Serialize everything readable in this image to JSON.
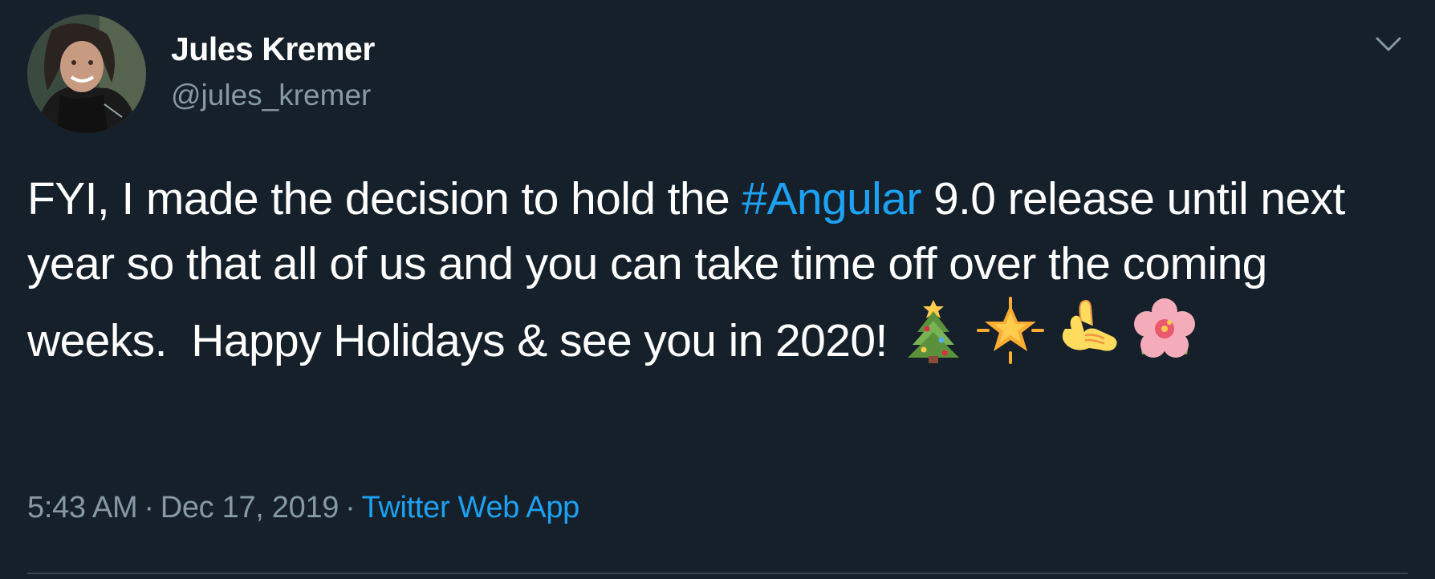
{
  "tweet": {
    "author": {
      "display_name": "Jules Kremer",
      "handle": "@jules_kremer"
    },
    "text": {
      "before_hashtag": "FYI, I made the decision to hold the ",
      "hashtag": "#Angular",
      "after_hashtag": " 9.0 release until next year so that all of us and you can take time off over the coming weeks.  Happy Holidays & see you in 2020! "
    },
    "emojis": [
      "christmas-tree",
      "sparkle-star",
      "call-me-hand",
      "hibiscus"
    ],
    "time": "5:43 AM",
    "separator": "·",
    "date": "Dec 17, 2019",
    "source": "Twitter Web App"
  },
  "colors": {
    "background": "#15202b",
    "text": "#ffffff",
    "secondary": "#8899a6",
    "link": "#1da1f2",
    "divider": "#38444d"
  }
}
